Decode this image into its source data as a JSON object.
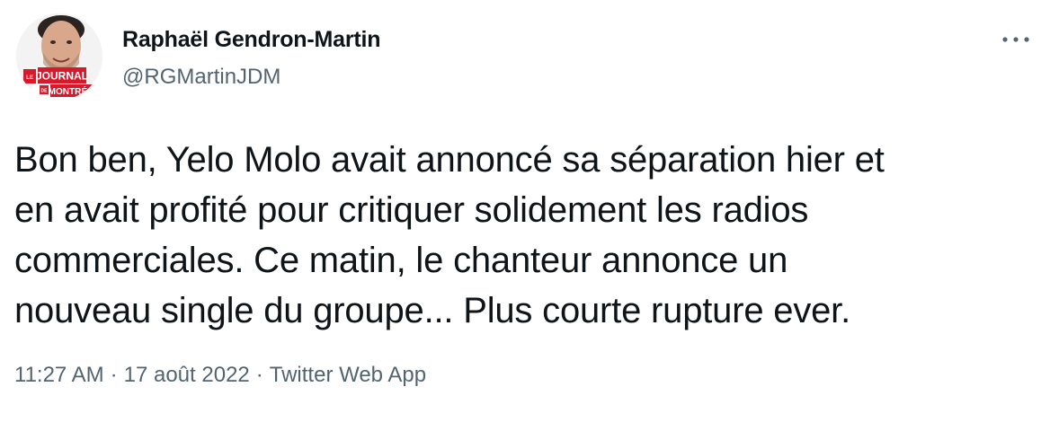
{
  "author": {
    "name": "Raphaël Gendron-Martin",
    "handle": "@RGMartinJDM",
    "avatar_badge": {
      "le": "LE",
      "journal": "JOURNAL",
      "de": "DE",
      "montreal": "MONTRÉAL"
    }
  },
  "more_icon": "more-horizontal-icon",
  "tweet": {
    "lines": [
      "Bon ben, Yelo Molo avait annoncé sa séparation hier et",
      "en avait profité pour critiquer solidement les radios",
      "commerciales. Ce matin, le chanteur annonce un",
      "nouveau single du groupe... Plus courte rupture ever."
    ]
  },
  "meta": {
    "time": "11:27 AM",
    "separator": "·",
    "date": "17 août 2022",
    "source": "Twitter Web App"
  },
  "colors": {
    "text": "#0f1419",
    "secondary": "#536471",
    "badge_red": "#d7192b"
  }
}
